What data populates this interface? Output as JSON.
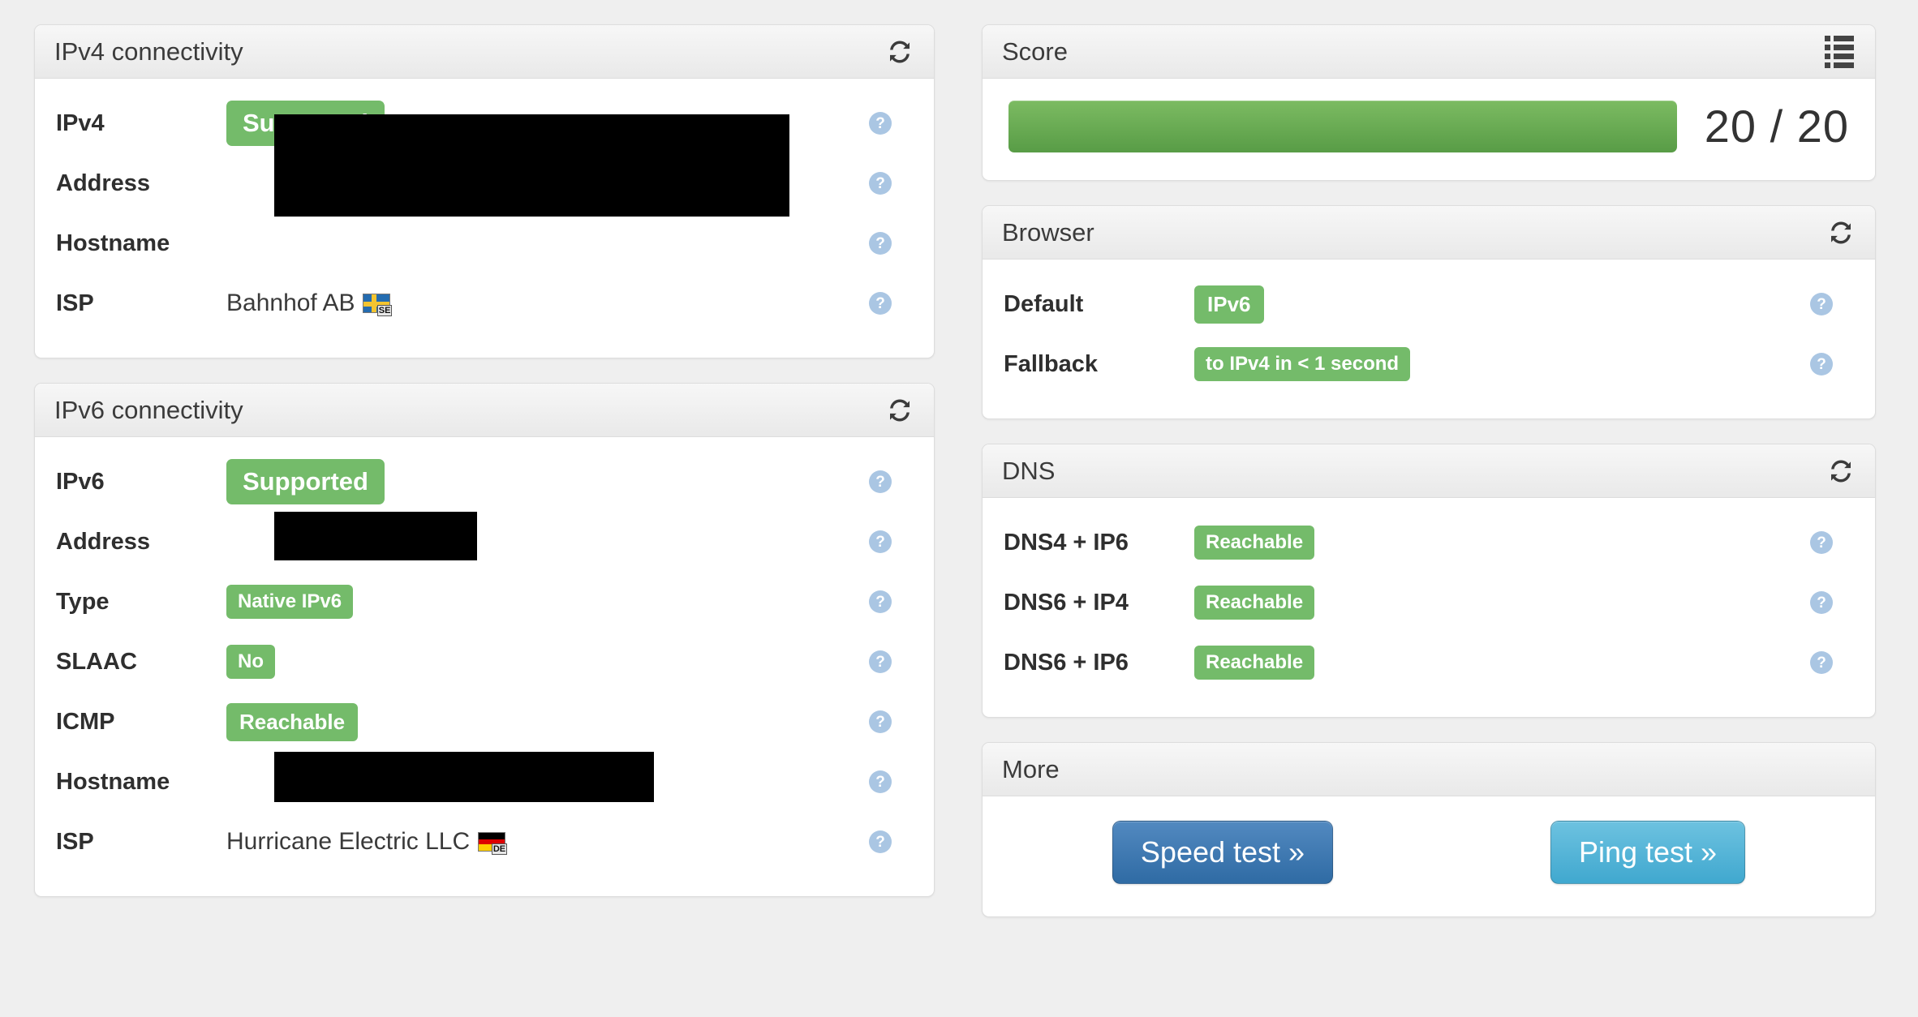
{
  "colors": {
    "badge_green": "#74bb6a",
    "score_green_top": "#7cbb62",
    "score_green_bottom": "#589c46",
    "help_blue": "#aac6e3",
    "speed_button_blue": "#2f6ba4",
    "ping_button_blue": "#40a8cf",
    "panel_border": "#dddddd",
    "page_background": "#efefef"
  },
  "ipv4_panel": {
    "title": "IPv4 connectivity",
    "refresh_icon": "refresh-icon",
    "rows": [
      {
        "label": "IPv4",
        "value": "Supported",
        "kind": "badge",
        "help": "?"
      },
      {
        "label": "Address",
        "value": "",
        "kind": "redacted",
        "help": "?"
      },
      {
        "label": "Hostname",
        "value": "",
        "kind": "redacted",
        "help": "?"
      },
      {
        "label": "ISP",
        "value": "Bahnhof AB",
        "kind": "text",
        "flag": "SE",
        "help": "?"
      }
    ]
  },
  "ipv6_panel": {
    "title": "IPv6 connectivity",
    "refresh_icon": "refresh-icon",
    "rows": [
      {
        "label": "IPv6",
        "value": "Supported",
        "kind": "badge",
        "help": "?"
      },
      {
        "label": "Address",
        "value": "",
        "kind": "redacted",
        "help": "?"
      },
      {
        "label": "Type",
        "value": "Native IPv6",
        "kind": "badge-sm",
        "help": "?"
      },
      {
        "label": "SLAAC",
        "value": "No",
        "kind": "badge-sm",
        "help": "?"
      },
      {
        "label": "ICMP",
        "value": "Reachable",
        "kind": "badge-md",
        "help": "?"
      },
      {
        "label": "Hostname",
        "value": "",
        "kind": "redacted",
        "help": "?"
      },
      {
        "label": "ISP",
        "value": "Hurricane Electric LLC",
        "kind": "text",
        "flag": "DE",
        "help": "?"
      }
    ]
  },
  "score_panel": {
    "title": "Score",
    "list_icon": "list-icon",
    "value": "20 / 20",
    "score": 20,
    "max_score": 20,
    "bar_percent": 100
  },
  "browser_panel": {
    "title": "Browser",
    "refresh_icon": "refresh-icon",
    "rows": [
      {
        "label": "Default",
        "value": "IPv6",
        "help": "?"
      },
      {
        "label": "Fallback",
        "value": "to IPv4 in < 1 second",
        "help": "?"
      }
    ]
  },
  "dns_panel": {
    "title": "DNS",
    "refresh_icon": "refresh-icon",
    "rows": [
      {
        "label": "DNS4 + IP6",
        "value": "Reachable",
        "help": "?"
      },
      {
        "label": "DNS6 + IP4",
        "value": "Reachable",
        "help": "?"
      },
      {
        "label": "DNS6 + IP6",
        "value": "Reachable",
        "help": "?"
      }
    ]
  },
  "more_panel": {
    "title": "More",
    "speed_test_label": "Speed test »",
    "ping_test_label": "Ping test »"
  }
}
